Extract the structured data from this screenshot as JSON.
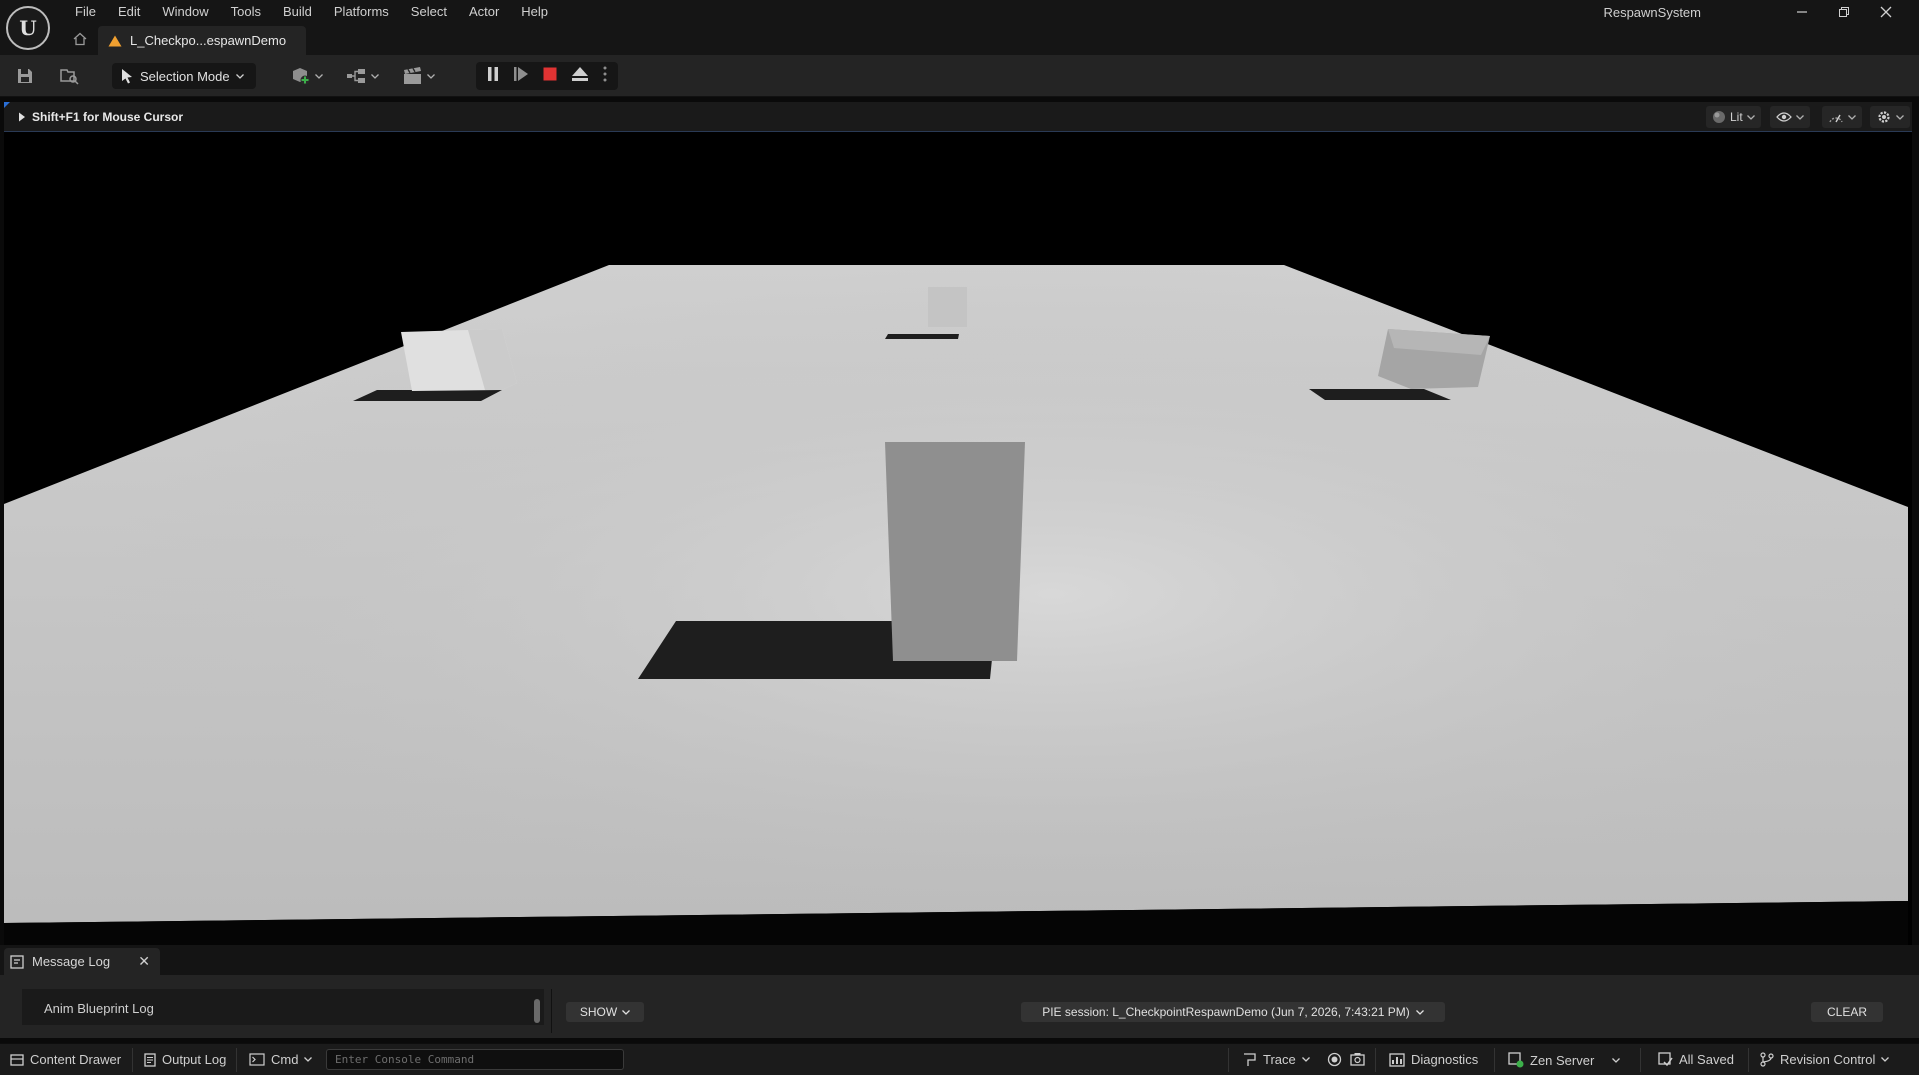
{
  "window": {
    "project_name": "RespawnSystem",
    "doc_tab_label": "L_Checkpo...espawnDemo"
  },
  "menu": [
    "File",
    "Edit",
    "Window",
    "Tools",
    "Build",
    "Platforms",
    "Select",
    "Actor",
    "Help"
  ],
  "toolbar": {
    "selection_mode_label": "Selection Mode"
  },
  "viewport": {
    "hint": "Shift+F1 for Mouse Cursor",
    "view_mode_label": "Lit"
  },
  "message_log": {
    "tab_label": "Message Log",
    "categories": [
      "Anim Blueprint Log"
    ],
    "show_label": "SHOW",
    "session_label": "PIE session: L_CheckpointRespawnDemo (Jun 7, 2026, 7:43:21 PM)",
    "clear_label": "CLEAR"
  },
  "statusbar": {
    "content_drawer": "Content Drawer",
    "output_log": "Output Log",
    "cmd": "Cmd",
    "console_placeholder": "Enter Console Command",
    "trace": "Trace",
    "diagnostics": "Diagnostics",
    "zen_server": "Zen Server",
    "all_saved": "All Saved",
    "revision_control": "Revision Control"
  },
  "colors": {
    "accent_blue": "#2a6fd6",
    "stop_red": "#e03333",
    "floor_light": "#c8c8c8",
    "warning_orange": "#f0a030",
    "zen_green": "#3cb04a"
  }
}
